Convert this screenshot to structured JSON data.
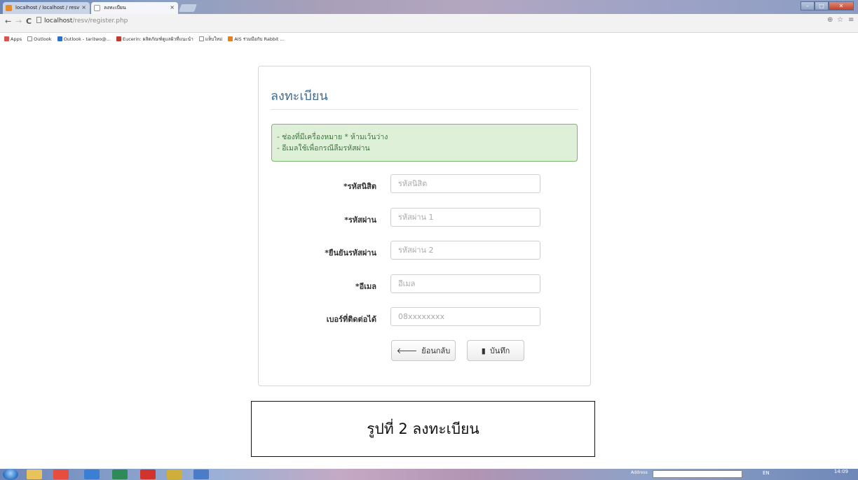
{
  "browser": {
    "tabs": [
      {
        "label": "localhost / localhost / resv"
      },
      {
        "label": "ลงทะเบียน"
      }
    ],
    "url_host": "localhost",
    "url_path": "/resv/register.php",
    "bookmarks": [
      {
        "label": "Apps",
        "color": "#d9534f"
      },
      {
        "label": "Outlook",
        "color": "#ffffff"
      },
      {
        "label": "Outlook - taritwo@...",
        "color": "#2f6fc7"
      },
      {
        "label": "Eucerin: ผลิตภัณฑ์ดูแลผิวที่แนะนำ",
        "color": "#c0392b"
      },
      {
        "label": "แท็บใหม่",
        "color": "#ffffff"
      },
      {
        "label": "AIS ร่วมมือกับ Rabbit ...",
        "color": "#e67e22"
      }
    ]
  },
  "form": {
    "title": "ลงทะเบียน",
    "alert_lines": [
      "- ช่องที่มีเครื่องหมาย * ห้ามเว้นว่าง",
      "- อีเมลใช้เพื่อกรณีลืมรหัสผ่าน"
    ],
    "fields": [
      {
        "label": "*รหัสนิสิต",
        "placeholder": "รหัสนิสิต"
      },
      {
        "label": "*รหัสผ่าน",
        "placeholder": "รหัสผ่าน 1"
      },
      {
        "label": "*ยืนยันรหัสผ่าน",
        "placeholder": "รหัสผ่าน 2"
      },
      {
        "label": "*อีเมล",
        "placeholder": "อีเมล"
      },
      {
        "label": "เบอร์ที่ติดต่อได้",
        "placeholder": "08xxxxxxxx"
      }
    ],
    "back_label": "ย้อนกลับ",
    "save_label": "บันทึก"
  },
  "caption": "รูปที่ 2  ลงทะเบียน",
  "taskbar": {
    "address_label": "Address",
    "tray_lang": "EN",
    "clock": "14:09"
  },
  "colors": {
    "title": "#3b6e99",
    "alert_bg": "#dff0d8",
    "alert_text": "#3c763d"
  }
}
